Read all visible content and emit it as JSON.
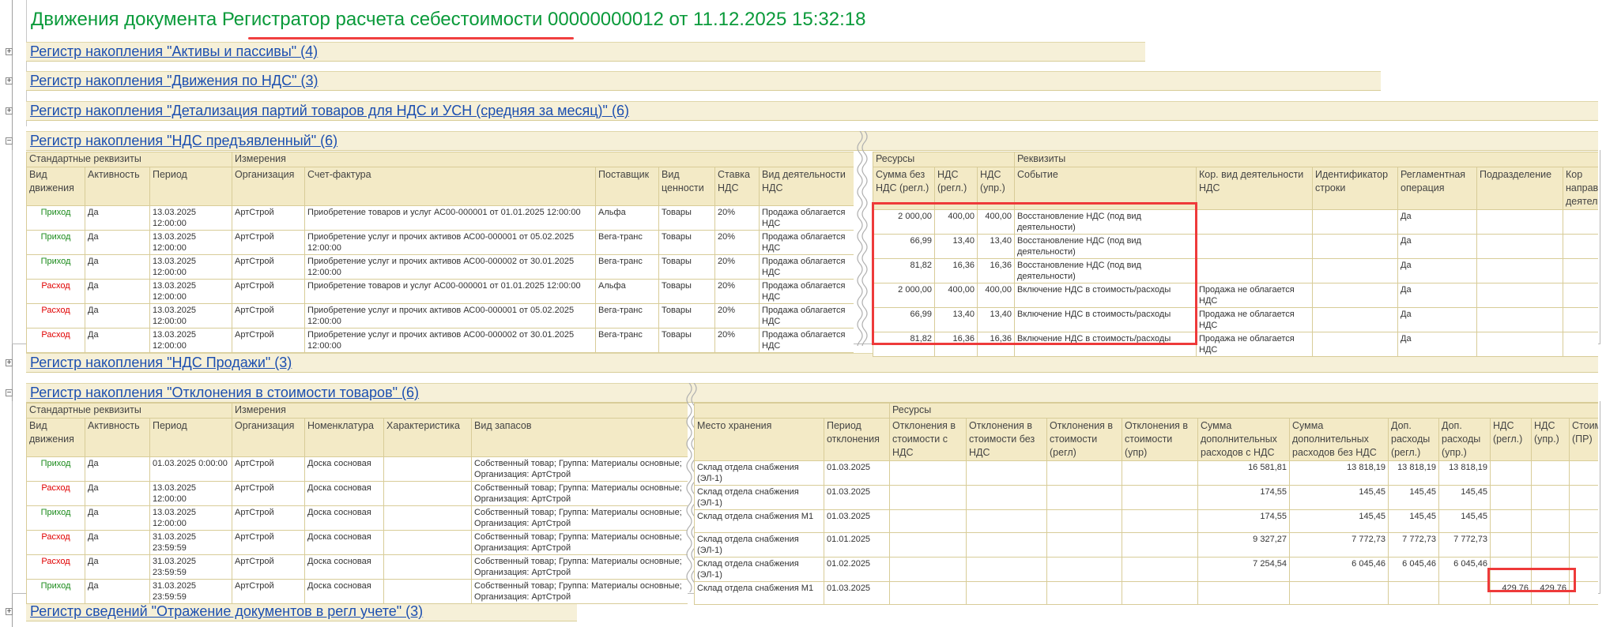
{
  "title": {
    "prefix": "Движения документа ",
    "doc_type": "Регистратор расчета себестоимости",
    "suffix": " 00000000012 от 11.12.2025 15:32:18"
  },
  "accent_colors": {
    "title": "#0a9a3a",
    "link": "#1c4fb0",
    "income": "#1a8a1a",
    "expense": "#e00000",
    "highlight": "#ee3a3a"
  },
  "icons": {
    "collapsed": "plus-box-icon",
    "expanded": "minus-box-icon"
  },
  "sections": [
    {
      "label": "Регистр накопления \"Активы и пассивы\" (4)",
      "expanded": false
    },
    {
      "label": "Регистр накопления \"Движения по НДС\" (3)",
      "expanded": false
    },
    {
      "label": "Регистр накопления \"Детализация партий товаров для НДС и УСН (средняя за месяц)\" (6)",
      "expanded": false
    },
    {
      "label": "Регистр накопления \"НДС предъявленный\" (6)",
      "expanded": true
    },
    {
      "label": "Регистр накопления \"НДС Продажи\" (3)",
      "expanded": false
    },
    {
      "label": "Регистр накопления \"Отклонения в стоимости товаров\" (6)",
      "expanded": true
    },
    {
      "label": "Регистр сведений \"Отражение документов в регл учете\" (3)",
      "expanded": false
    }
  ],
  "table_vat": {
    "left_groups": [
      "Стандартные реквизиты",
      "Измерения"
    ],
    "right_groups": [
      "Ресурсы",
      "Реквизиты"
    ],
    "left_columns": [
      "Вид движения",
      "Активность",
      "Период",
      "Организация",
      "Счет-фактура",
      "Поставщик",
      "Вид ценности",
      "Ставка НДС",
      "Вид деятельности НДС"
    ],
    "right_columns": [
      "Сумма без НДС (регл.)",
      "НДС (регл.)",
      "НДС (упр.)",
      "Событие",
      "Кор. вид деятельности НДС",
      "Идентификатор строки",
      "Регламентная операция",
      "Подразделение",
      "Кор направ деятел"
    ],
    "rows": [
      {
        "left": [
          "Приход",
          "Да",
          "13.03.2025 12:00:00",
          "АртСтрой",
          "Приобретение товаров и услуг АС00-000001 от 01.01.2025 12:00:00",
          "Альфа",
          "Товары",
          "20%",
          "Продажа облагается НДС"
        ],
        "right": [
          "2 000,00",
          "400,00",
          "400,00",
          "Восстановление НДС (под вид деятельности)",
          "",
          "",
          "Да",
          "",
          ""
        ]
      },
      {
        "left": [
          "Приход",
          "Да",
          "13.03.2025 12:00:00",
          "АртСтрой",
          "Приобретение услуг и прочих активов АС00-000001 от 05.02.2025 12:00:00",
          "Вега-транс",
          "Товары",
          "20%",
          "Продажа облагается НДС"
        ],
        "right": [
          "66,99",
          "13,40",
          "13,40",
          "Восстановление НДС (под вид деятельности)",
          "",
          "",
          "Да",
          "",
          ""
        ]
      },
      {
        "left": [
          "Приход",
          "Да",
          "13.03.2025 12:00:00",
          "АртСтрой",
          "Приобретение услуг и прочих активов АС00-000002 от 30.01.2025 12:00:00",
          "Вега-транс",
          "Товары",
          "20%",
          "Продажа облагается НДС"
        ],
        "right": [
          "81,82",
          "16,36",
          "16,36",
          "Восстановление НДС (под вид деятельности)",
          "",
          "",
          "Да",
          "",
          ""
        ]
      },
      {
        "left": [
          "Расход",
          "Да",
          "13.03.2025 12:00:00",
          "АртСтрой",
          "Приобретение товаров и услуг АС00-000001 от 01.01.2025 12:00:00",
          "Альфа",
          "Товары",
          "20%",
          "Продажа облагается НДС"
        ],
        "right": [
          "2 000,00",
          "400,00",
          "400,00",
          "Включение НДС в стоимость/расходы",
          "Продажа не облагается НДС",
          "",
          "Да",
          "",
          ""
        ]
      },
      {
        "left": [
          "Расход",
          "Да",
          "13.03.2025 12:00:00",
          "АртСтрой",
          "Приобретение услуг и прочих активов АС00-000001 от 05.02.2025 12:00:00",
          "Вега-транс",
          "Товары",
          "20%",
          "Продажа облагается НДС"
        ],
        "right": [
          "66,99",
          "13,40",
          "13,40",
          "Включение НДС в стоимость/расходы",
          "Продажа не облагается НДС",
          "",
          "Да",
          "",
          ""
        ]
      },
      {
        "left": [
          "Расход",
          "Да",
          "13.03.2025 12:00:00",
          "АртСтрой",
          "Приобретение услуг и прочих активов АС00-000002 от 30.01.2025 12:00:00",
          "Вега-транс",
          "Товары",
          "20%",
          "Продажа облагается НДС"
        ],
        "right": [
          "81,82",
          "16,36",
          "16,36",
          "Включение НДС в стоимость/расходы",
          "Продажа не облагается НДС",
          "",
          "Да",
          "",
          ""
        ]
      }
    ]
  },
  "table_dev": {
    "left_groups": [
      "Стандартные реквизиты",
      "Измерения"
    ],
    "right_groups": [
      "",
      "Ресурсы"
    ],
    "left_columns": [
      "Вид движения",
      "Активность",
      "Период",
      "Организация",
      "Номенклатура",
      "Характеристика",
      "Вид запасов"
    ],
    "right_columns": [
      "Место хранения",
      "Период отклонения",
      "Отклонения в стоимости с НДС",
      "Отклонения в стоимости без НДС",
      "Отклонения в стоимости (регл)",
      "Отклонения в стоимости (упр)",
      "Сумма дополнительных расходов с НДС",
      "Сумма дополнительных расходов без НДС",
      "Доп. расходы (регл.)",
      "Доп. расходы (упр.)",
      "НДС (регл.)",
      "НДС (упр.)",
      "Стоим (ПР)"
    ],
    "rows": [
      {
        "left": [
          "Приход",
          "Да",
          "01.03.2025 0:00:00",
          "АртСтрой",
          "Доска сосновая",
          "",
          "Собственный товар; Группа: Материалы основные; Организация: АртСтрой"
        ],
        "right": [
          "Склад отдела снабжения (ЭЛ-1)",
          "01.03.2025",
          "",
          "",
          "",
          "",
          "16 581,81",
          "13 818,19",
          "13 818,19",
          "13 818,19",
          "",
          "",
          ""
        ]
      },
      {
        "left": [
          "Расход",
          "Да",
          "13.03.2025 12:00:00",
          "АртСтрой",
          "Доска сосновая",
          "",
          "Собственный товар; Группа: Материалы основные; Организация: АртСтрой"
        ],
        "right": [
          "Склад отдела снабжения (ЭЛ-1)",
          "01.03.2025",
          "",
          "",
          "",
          "",
          "174,55",
          "145,45",
          "145,45",
          "145,45",
          "",
          "",
          ""
        ]
      },
      {
        "left": [
          "Приход",
          "Да",
          "13.03.2025 12:00:00",
          "АртСтрой",
          "Доска сосновая",
          "",
          "Собственный товар; Группа: Материалы основные; Организация: АртСтрой"
        ],
        "right": [
          "Склад отдела снабжения М1",
          "01.03.2025",
          "",
          "",
          "",
          "",
          "174,55",
          "145,45",
          "145,45",
          "145,45",
          "",
          "",
          ""
        ]
      },
      {
        "left": [
          "Расход",
          "Да",
          "31.03.2025 23:59:59",
          "АртСтрой",
          "Доска сосновая",
          "",
          "Собственный товар; Группа: Материалы основные; Организация: АртСтрой"
        ],
        "right": [
          "Склад отдела снабжения (ЭЛ-1)",
          "01.01.2025",
          "",
          "",
          "",
          "",
          "9 327,27",
          "7 772,73",
          "7 772,73",
          "7 772,73",
          "",
          "",
          ""
        ]
      },
      {
        "left": [
          "Расход",
          "Да",
          "31.03.2025 23:59:59",
          "АртСтрой",
          "Доска сосновая",
          "",
          "Собственный товар; Группа: Материалы основные; Организация: АртСтрой"
        ],
        "right": [
          "Склад отдела снабжения (ЭЛ-1)",
          "01.02.2025",
          "",
          "",
          "",
          "",
          "7 254,54",
          "6 045,46",
          "6 045,46",
          "6 045,46",
          "",
          "",
          ""
        ]
      },
      {
        "left": [
          "Приход",
          "Да",
          "31.03.2025 23:59:59",
          "АртСтрой",
          "Доска сосновая",
          "",
          "Собственный товар; Группа: Материалы основные; Организация: АртСтрой"
        ],
        "right": [
          "Склад отдела снабжения М1",
          "01.03.2025",
          "",
          "",
          "",
          "",
          "",
          "",
          "",
          "",
          "429,76",
          "429,76",
          ""
        ]
      }
    ]
  }
}
